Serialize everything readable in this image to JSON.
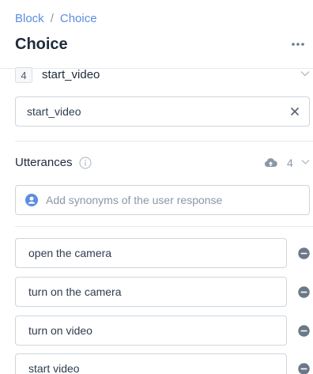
{
  "breadcrumb": {
    "parent": "Block",
    "separator": "/",
    "current": "Choice"
  },
  "title": "Choice",
  "choice": {
    "index": "4",
    "name": "start_video"
  },
  "name_field": {
    "value": "start_video"
  },
  "utterances": {
    "label": "Utterances",
    "count": "4",
    "input_placeholder": "Add synonyms of the user response",
    "items": [
      {
        "text": "open the camera"
      },
      {
        "text": "turn on the camera"
      },
      {
        "text": "turn on video"
      },
      {
        "text": "start video"
      }
    ]
  },
  "colors": {
    "link": "#5b8de0",
    "icon_gray": "#8a97a8",
    "remove_gray": "#6b7889",
    "user_icon": "#5b8de0",
    "border": "#cfd5dd"
  }
}
